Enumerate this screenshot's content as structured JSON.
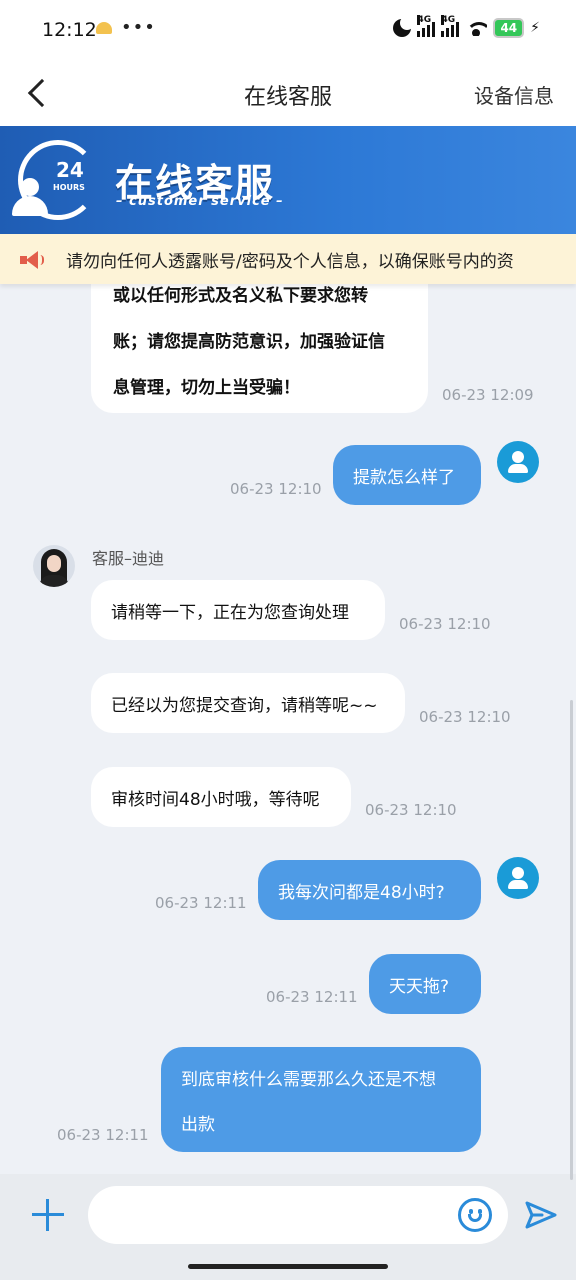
{
  "status_bar": {
    "time": "12:12",
    "dots": "•••",
    "network_1": "4G",
    "network_2": "4G",
    "battery": "44"
  },
  "header": {
    "title": "在线客服",
    "device_info": "设备信息"
  },
  "banner": {
    "title": "在线客服",
    "subtitle": "– customer service –",
    "badge_number": "24",
    "badge_text": "HOURS"
  },
  "notice": {
    "text": "请勿向任何人透露账号/密码及个人信息，以确保账号内的资"
  },
  "messages": {
    "partial_agent": {
      "lines": [
        "或以任何形式及名义私下要求您转",
        "账；请您提高防范意识，加强验证信",
        "息管理，切勿上当受骗！"
      ],
      "time": "06-23 12:09"
    },
    "user_1": {
      "text": "提款怎么样了",
      "time": "06-23 12:10"
    },
    "agent_name": "客服–迪迪",
    "agent_1": {
      "text": "请稍等一下，正在为您查询处理",
      "time": "06-23 12:10"
    },
    "agent_2": {
      "text": "已经以为您提交查询，请稍等呢~~",
      "time": "06-23 12:10"
    },
    "agent_3": {
      "text": "审核时间48小时哦，等待呢",
      "time": "06-23 12:10"
    },
    "user_2": {
      "text": "我每次问都是48小时?",
      "time": "06-23 12:11"
    },
    "user_3": {
      "text": "天天拖?",
      "time": "06-23 12:11"
    },
    "user_4": {
      "lines": [
        "到底审核什么需要那么久还是不想",
        "出款"
      ],
      "time": "06-23 12:11"
    }
  },
  "input": {
    "placeholder": ""
  },
  "colors": {
    "accent": "#4e9be6",
    "icon_blue": "#2a8bd9",
    "banner_blue": "#1f5db4",
    "notice_bg": "#fdf3d7"
  }
}
